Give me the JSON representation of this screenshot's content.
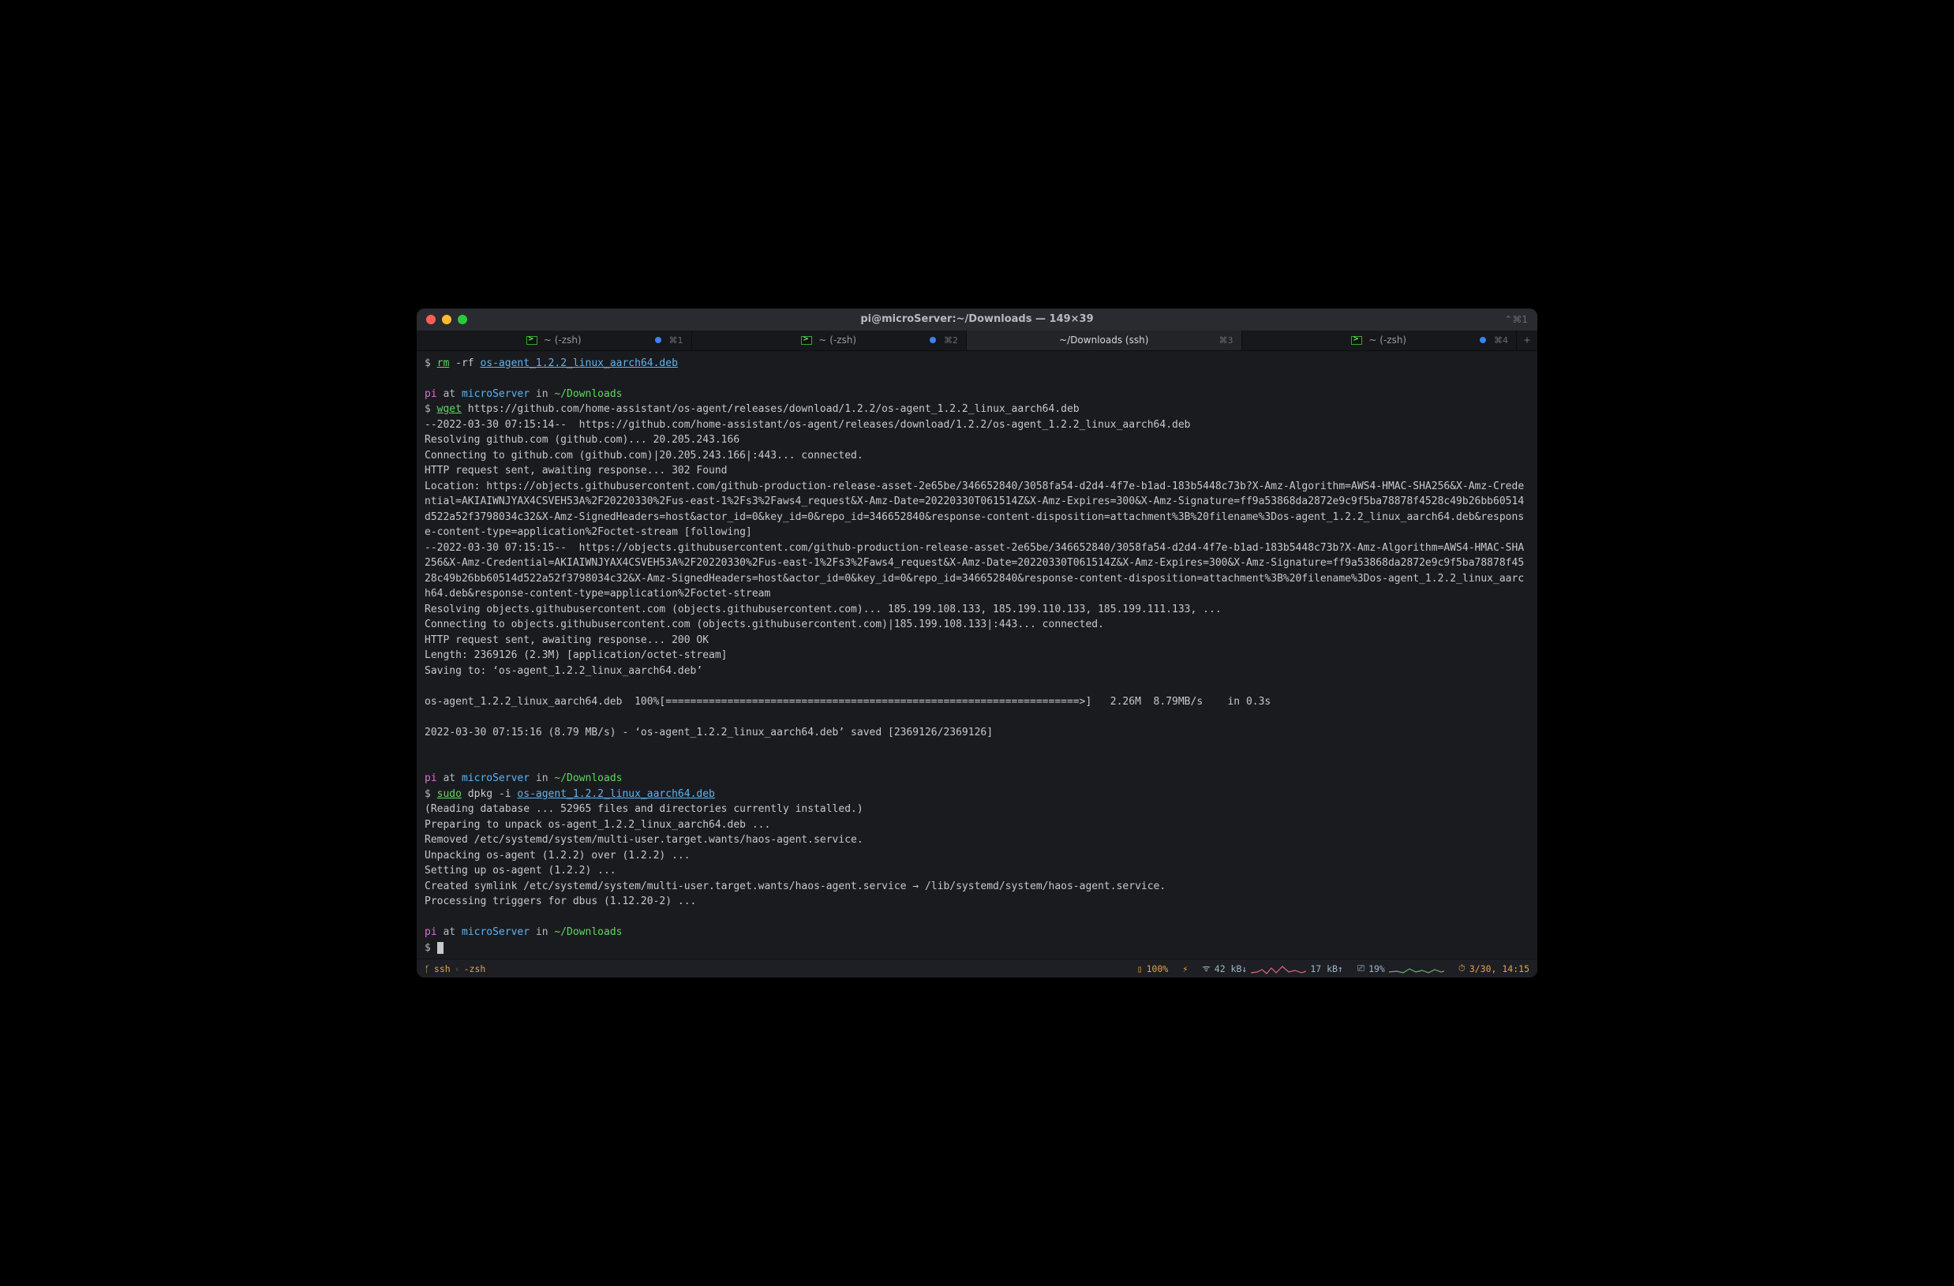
{
  "window": {
    "title": "pi@microServer:~/Downloads — 149×39",
    "hotkey_hint": "⌃⌘1"
  },
  "tabs": [
    {
      "label": "~ (-zsh)",
      "hotkey": "⌘1",
      "active": false,
      "dot": true
    },
    {
      "label": "~ (-zsh)",
      "hotkey": "⌘2",
      "active": false,
      "dot": true
    },
    {
      "label": "~/Downloads (ssh)",
      "hotkey": "⌘3",
      "active": true,
      "dot": false
    },
    {
      "label": "~ (-zsh)",
      "hotkey": "⌘4",
      "active": false,
      "dot": true
    }
  ],
  "prompt": {
    "user": "pi",
    "at": "at",
    "host": "microServer",
    "in": "in",
    "path": "~/Downloads",
    "symbol": "$"
  },
  "cmd1": {
    "prog": "rm",
    "flags": "-rf",
    "arg": "os-agent_1.2.2_linux_aarch64.deb"
  },
  "cmd2": {
    "prog": "wget",
    "arg": "https://github.com/home-assistant/os-agent/releases/download/1.2.2/os-agent_1.2.2_linux_aarch64.deb"
  },
  "wget_output": "--2022-03-30 07:15:14--  https://github.com/home-assistant/os-agent/releases/download/1.2.2/os-agent_1.2.2_linux_aarch64.deb\nResolving github.com (github.com)... 20.205.243.166\nConnecting to github.com (github.com)|20.205.243.166|:443... connected.\nHTTP request sent, awaiting response... 302 Found\nLocation: https://objects.githubusercontent.com/github-production-release-asset-2e65be/346652840/3058fa54-d2d4-4f7e-b1ad-183b5448c73b?X-Amz-Algorithm=AWS4-HMAC-SHA256&X-Amz-Credential=AKIAIWNJYAX4CSVEH53A%2F20220330%2Fus-east-1%2Fs3%2Faws4_request&X-Amz-Date=20220330T061514Z&X-Amz-Expires=300&X-Amz-Signature=ff9a53868da2872e9c9f5ba78878f4528c49b26bb60514d522a52f3798034c32&X-Amz-SignedHeaders=host&actor_id=0&key_id=0&repo_id=346652840&response-content-disposition=attachment%3B%20filename%3Dos-agent_1.2.2_linux_aarch64.deb&response-content-type=application%2Foctet-stream [following]\n--2022-03-30 07:15:15--  https://objects.githubusercontent.com/github-production-release-asset-2e65be/346652840/3058fa54-d2d4-4f7e-b1ad-183b5448c73b?X-Amz-Algorithm=AWS4-HMAC-SHA256&X-Amz-Credential=AKIAIWNJYAX4CSVEH53A%2F20220330%2Fus-east-1%2Fs3%2Faws4_request&X-Amz-Date=20220330T061514Z&X-Amz-Expires=300&X-Amz-Signature=ff9a53868da2872e9c9f5ba78878f4528c49b26bb60514d522a52f3798034c32&X-Amz-SignedHeaders=host&actor_id=0&key_id=0&repo_id=346652840&response-content-disposition=attachment%3B%20filename%3Dos-agent_1.2.2_linux_aarch64.deb&response-content-type=application%2Foctet-stream\nResolving objects.githubusercontent.com (objects.githubusercontent.com)... 185.199.108.133, 185.199.110.133, 185.199.111.133, ...\nConnecting to objects.githubusercontent.com (objects.githubusercontent.com)|185.199.108.133|:443... connected.\nHTTP request sent, awaiting response... 200 OK\nLength: 2369126 (2.3M) [application/octet-stream]\nSaving to: ‘os-agent_1.2.2_linux_aarch64.deb’\n\nos-agent_1.2.2_linux_aarch64.deb  100%[===================================================================>]   2.26M  8.79MB/s    in 0.3s\n\n2022-03-30 07:15:16 (8.79 MB/s) - ‘os-agent_1.2.2_linux_aarch64.deb’ saved [2369126/2369126]\n",
  "cmd3": {
    "sudo": "sudo",
    "prog": "dpkg",
    "flags": "-i",
    "arg": "os-agent_1.2.2_linux_aarch64.deb"
  },
  "dpkg_output": "(Reading database ... 52965 files and directories currently installed.)\nPreparing to unpack os-agent_1.2.2_linux_aarch64.deb ...\nRemoved /etc/systemd/system/multi-user.target.wants/haos-agent.service.\nUnpacking os-agent (1.2.2) over (1.2.2) ...\nSetting up os-agent (1.2.2) ...\nCreated symlink /etc/systemd/system/multi-user.target.wants/haos-agent.service → /lib/systemd/system/haos-agent.service.\nProcessing triggers for dbus (1.12.20-2) ...",
  "statusbar": {
    "left1_icon": "ᚶ",
    "left1": "ssh",
    "left2": "-zsh",
    "battery_icon": "▯",
    "battery": "100%",
    "bolt": "⚡",
    "net_icon": "ᯤ",
    "down": "42 kB↓",
    "up": "17 kB↑",
    "cpu_icon": "⎚",
    "cpu": "19%",
    "clock_icon": "⏱",
    "clock": "3/30, 14:15"
  }
}
